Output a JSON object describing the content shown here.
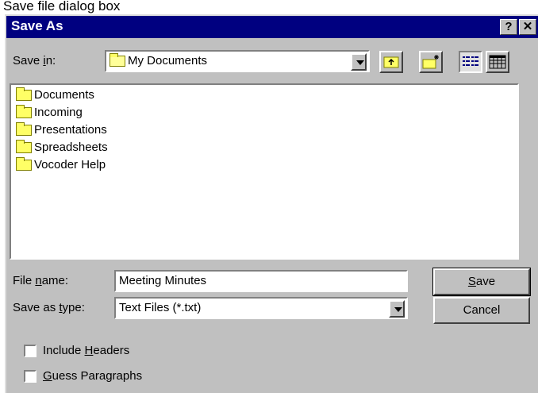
{
  "caption": "Save file dialog box",
  "titlebar": {
    "title": "Save As",
    "help_label": "?",
    "close_label": "✕"
  },
  "save_in": {
    "label_pre": "Save ",
    "label_u": "i",
    "label_post": "n:",
    "value": "My Documents"
  },
  "toolbar": {
    "up_icon": "up-one-level-icon",
    "new_folder_icon": "new-folder-icon",
    "list_icon": "list-view-icon",
    "details_icon": "details-view-icon"
  },
  "files": [
    {
      "name": "Documents"
    },
    {
      "name": "Incoming"
    },
    {
      "name": "Presentations"
    },
    {
      "name": "Spreadsheets"
    },
    {
      "name": "Vocoder Help"
    }
  ],
  "file_name": {
    "label_pre": "File ",
    "label_u": "n",
    "label_post": "ame:",
    "value": "Meeting Minutes"
  },
  "save_as_type": {
    "label_pre": "Save as ",
    "label_u": "t",
    "label_post": "ype:",
    "value": "Text Files (*.txt)"
  },
  "buttons": {
    "save_u": "S",
    "save_post": "ave",
    "cancel": "Cancel"
  },
  "options": {
    "include_headers_pre": "Include ",
    "include_headers_u": "H",
    "include_headers_post": "eaders",
    "include_headers_checked": false,
    "guess_paragraphs_u": "G",
    "guess_paragraphs_post": "uess Paragraphs",
    "guess_paragraphs_checked": false
  }
}
